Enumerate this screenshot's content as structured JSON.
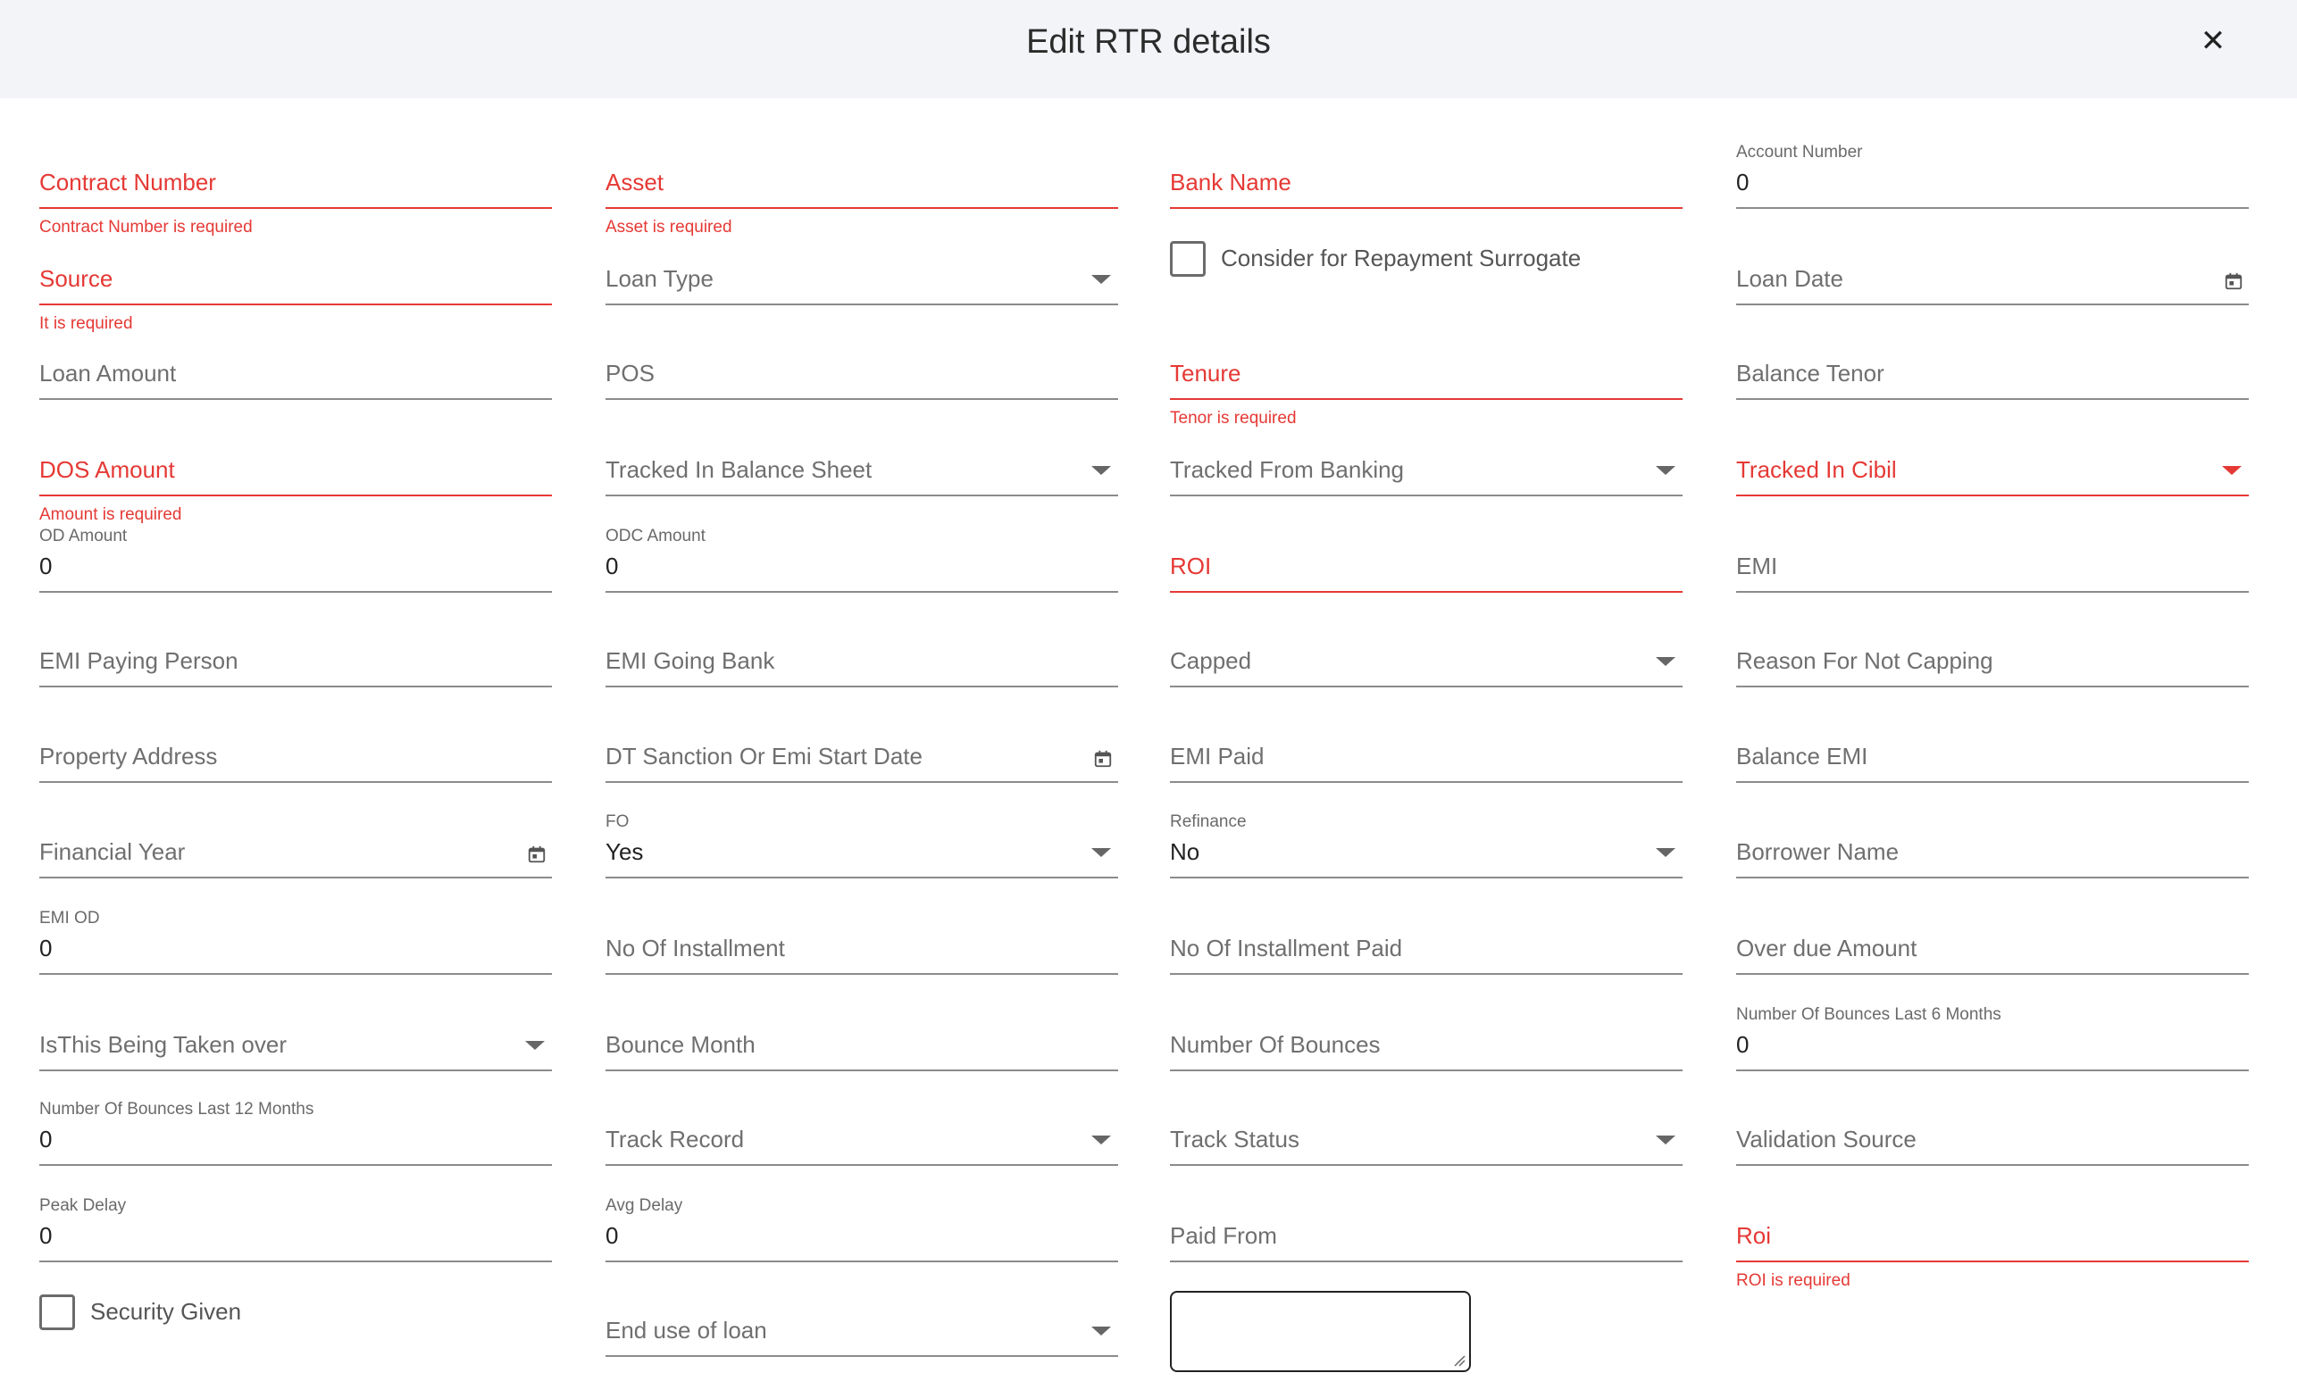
{
  "dialog": {
    "title": "Edit RTR details",
    "close_icon": "close-icon",
    "close_symbol": "✕"
  },
  "colors": {
    "error": "#e53935",
    "header_bg": "#f3f4f8",
    "line": "#8b8b8b"
  },
  "fields": {
    "contract_number": {
      "label": "Contract Number",
      "error": "Contract Number is required"
    },
    "asset": {
      "label": "Asset",
      "error": "Asset is required"
    },
    "bank_name": {
      "label": "Bank Name"
    },
    "account_number": {
      "label": "Account Number",
      "value": "0"
    },
    "source": {
      "label": "Source",
      "error": "It is required"
    },
    "loan_type": {
      "label": "Loan Type"
    },
    "consider_repayment": {
      "label": "Consider for Repayment Surrogate",
      "checked": false
    },
    "loan_date": {
      "label": "Loan Date"
    },
    "loan_amount": {
      "label": "Loan Amount"
    },
    "pos": {
      "label": "POS"
    },
    "tenure": {
      "label": "Tenure",
      "error": "Tenor is required"
    },
    "balance_tenor": {
      "label": "Balance Tenor"
    },
    "dos_amount": {
      "label": "DOS Amount",
      "error": "Amount is required"
    },
    "tracked_balance_sheet": {
      "label": "Tracked In Balance Sheet"
    },
    "tracked_banking": {
      "label": "Tracked From Banking"
    },
    "tracked_cibil": {
      "label": "Tracked In Cibil"
    },
    "od_amount": {
      "label": "OD Amount",
      "value": "0"
    },
    "odc_amount": {
      "label": "ODC Amount",
      "value": "0"
    },
    "roi": {
      "label": "ROI"
    },
    "emi": {
      "label": "EMI"
    },
    "emi_paying_person": {
      "label": "EMI Paying Person"
    },
    "emi_going_bank": {
      "label": "EMI Going Bank"
    },
    "capped": {
      "label": "Capped"
    },
    "reason_not_capping": {
      "label": "Reason For Not Capping"
    },
    "property_address": {
      "label": "Property Address"
    },
    "dt_sanction": {
      "label": "DT Sanction Or Emi Start Date"
    },
    "emi_paid": {
      "label": "EMI Paid"
    },
    "balance_emi": {
      "label": "Balance EMI"
    },
    "financial_year": {
      "label": "Financial Year"
    },
    "fo": {
      "label": "FO",
      "value": "Yes"
    },
    "refinance": {
      "label": "Refinance",
      "value": "No"
    },
    "borrower_name": {
      "label": "Borrower Name"
    },
    "emi_od": {
      "label": "EMI OD",
      "value": "0"
    },
    "no_installment": {
      "label": "No Of Installment"
    },
    "no_installment_paid": {
      "label": "No Of Installment Paid"
    },
    "overdue_amount": {
      "label": "Over due Amount"
    },
    "taken_over": {
      "label": "IsThis Being Taken over"
    },
    "bounce_month": {
      "label": "Bounce Month"
    },
    "number_bounces": {
      "label": "Number Of Bounces"
    },
    "bounces_6m": {
      "label": "Number Of Bounces Last 6 Months",
      "value": "0"
    },
    "bounces_12m": {
      "label": "Number Of Bounces Last 12 Months",
      "value": "0"
    },
    "track_record": {
      "label": "Track Record"
    },
    "track_status": {
      "label": "Track Status"
    },
    "validation_source": {
      "label": "Validation Source"
    },
    "peak_delay": {
      "label": "Peak Delay",
      "value": "0"
    },
    "avg_delay": {
      "label": "Avg Delay",
      "value": "0"
    },
    "paid_from": {
      "label": "Paid From"
    },
    "roi2": {
      "label": "Roi",
      "error": "ROI is required"
    },
    "security_given": {
      "label": "Security Given",
      "checked": false
    },
    "end_use": {
      "label": "End use of loan"
    }
  }
}
